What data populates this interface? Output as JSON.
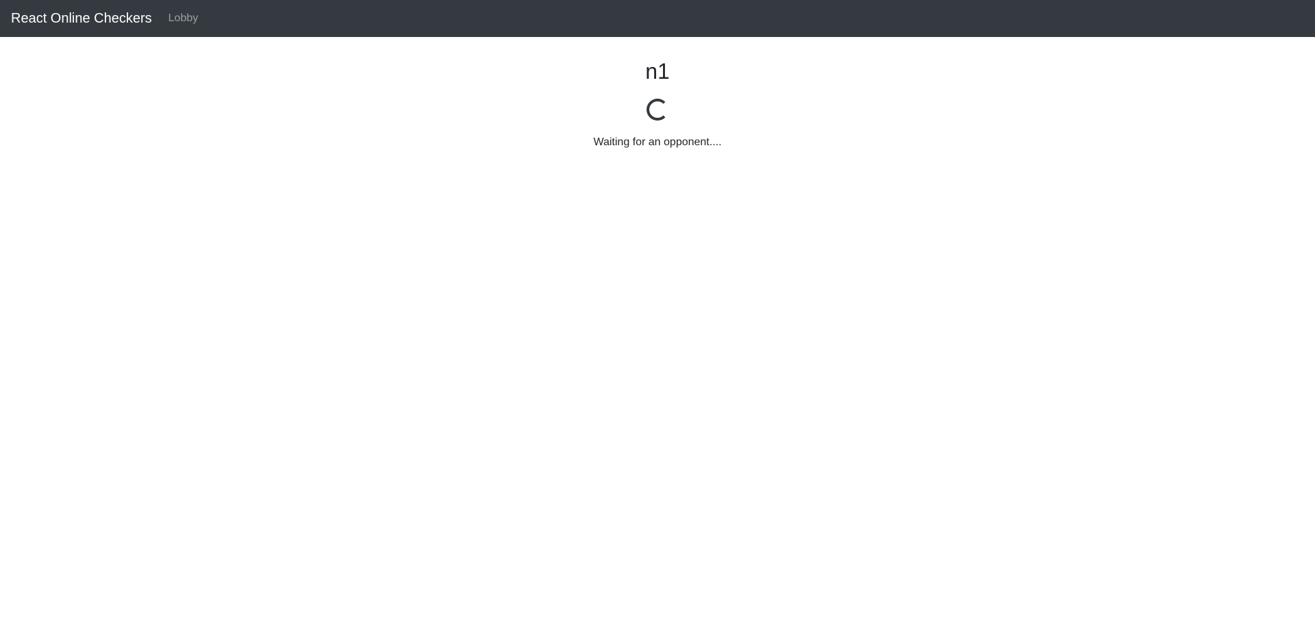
{
  "navbar": {
    "brand": "React Online Checkers",
    "links": [
      {
        "label": "Lobby"
      }
    ],
    "background_color": "#343a40"
  },
  "main": {
    "room_name": "n1",
    "loading_indicator": "spinner",
    "status_text": "Waiting for an opponent...."
  }
}
